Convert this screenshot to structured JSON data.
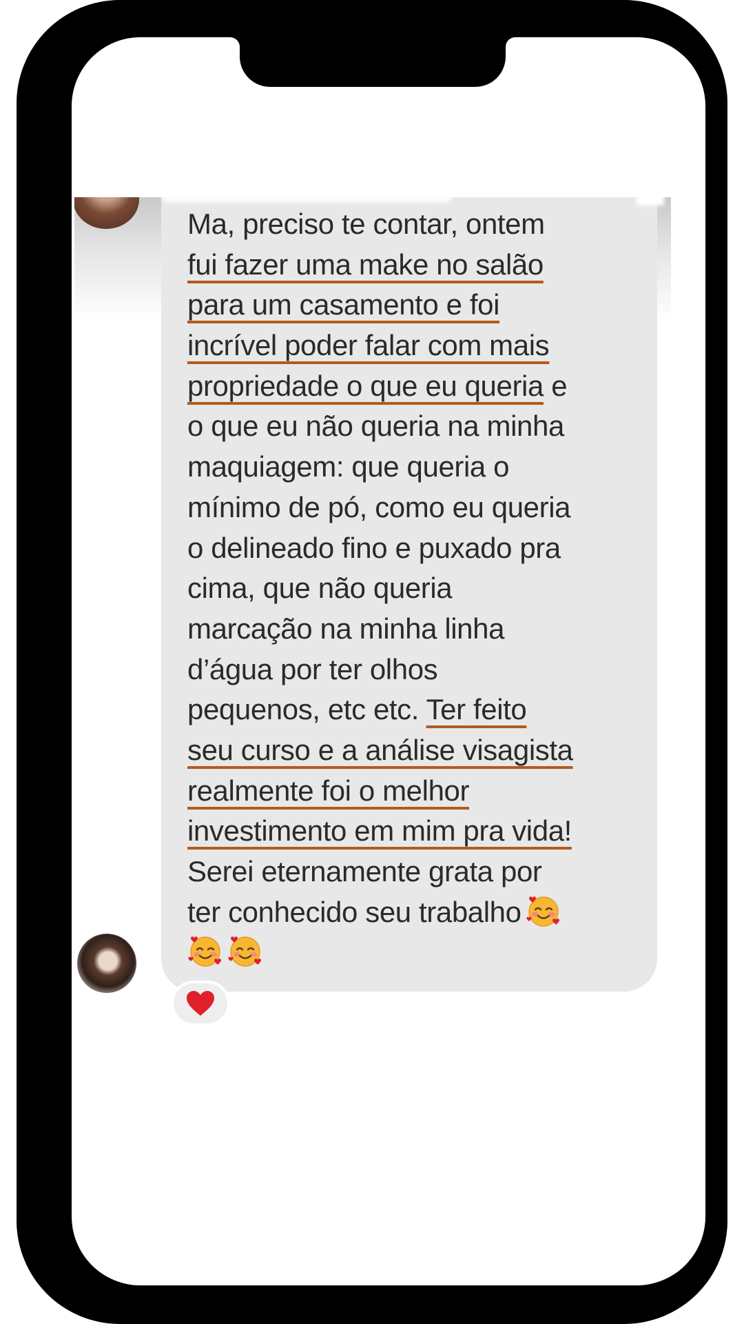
{
  "message": {
    "lines": [
      {
        "segments": [
          {
            "text": "Ma, preciso te contar, ontem",
            "underlined": false
          }
        ]
      },
      {
        "segments": [
          {
            "text": "fui fazer uma make no salão",
            "underlined": true
          }
        ]
      },
      {
        "segments": [
          {
            "text": "para um casamento e foi",
            "underlined": true
          }
        ]
      },
      {
        "segments": [
          {
            "text": "incrível poder falar com mais",
            "underlined": true
          }
        ]
      },
      {
        "segments": [
          {
            "text": "propriedade o que eu queria",
            "underlined": true
          },
          {
            "text": " e",
            "underlined": false
          }
        ]
      },
      {
        "segments": [
          {
            "text": "o que eu não queria na minha",
            "underlined": false
          }
        ]
      },
      {
        "segments": [
          {
            "text": "maquiagem: que queria o",
            "underlined": false
          }
        ]
      },
      {
        "segments": [
          {
            "text": "mínimo de pó, como eu queria",
            "underlined": false
          }
        ]
      },
      {
        "segments": [
          {
            "text": "o delineado fino e puxado pra",
            "underlined": false
          }
        ]
      },
      {
        "segments": [
          {
            "text": "cima, que não queria",
            "underlined": false
          }
        ]
      },
      {
        "segments": [
          {
            "text": "marcação na minha linha",
            "underlined": false
          }
        ]
      },
      {
        "segments": [
          {
            "text": "d’água por ter olhos",
            "underlined": false
          }
        ]
      },
      {
        "segments": [
          {
            "text": "pequenos, etc etc. ",
            "underlined": false
          },
          {
            "text": "Ter feito",
            "underlined": true
          }
        ]
      },
      {
        "segments": [
          {
            "text": "seu curso e a análise visagista",
            "underlined": true
          }
        ]
      },
      {
        "segments": [
          {
            "text": "realmente foi o melhor",
            "underlined": true
          }
        ]
      },
      {
        "segments": [
          {
            "text": "investimento em mim pra vida!",
            "underlined": true
          }
        ]
      },
      {
        "segments": [
          {
            "text": "Serei eternamente grata por",
            "underlined": false
          }
        ]
      },
      {
        "segments": [
          {
            "text": "ter conhecido seu trabalho",
            "underlined": false
          }
        ]
      }
    ],
    "trailing_emoji": "smiling-face-with-hearts",
    "emoji_row": [
      "smiling-face-with-hearts",
      "smiling-face-with-hearts"
    ]
  },
  "reaction": {
    "icon": "red-heart-icon",
    "color": "#e0202b"
  },
  "colors": {
    "bubble": "#e8e8e8",
    "text": "#2a2a2a",
    "underline": "#b35a1f",
    "frame": "#000000"
  }
}
